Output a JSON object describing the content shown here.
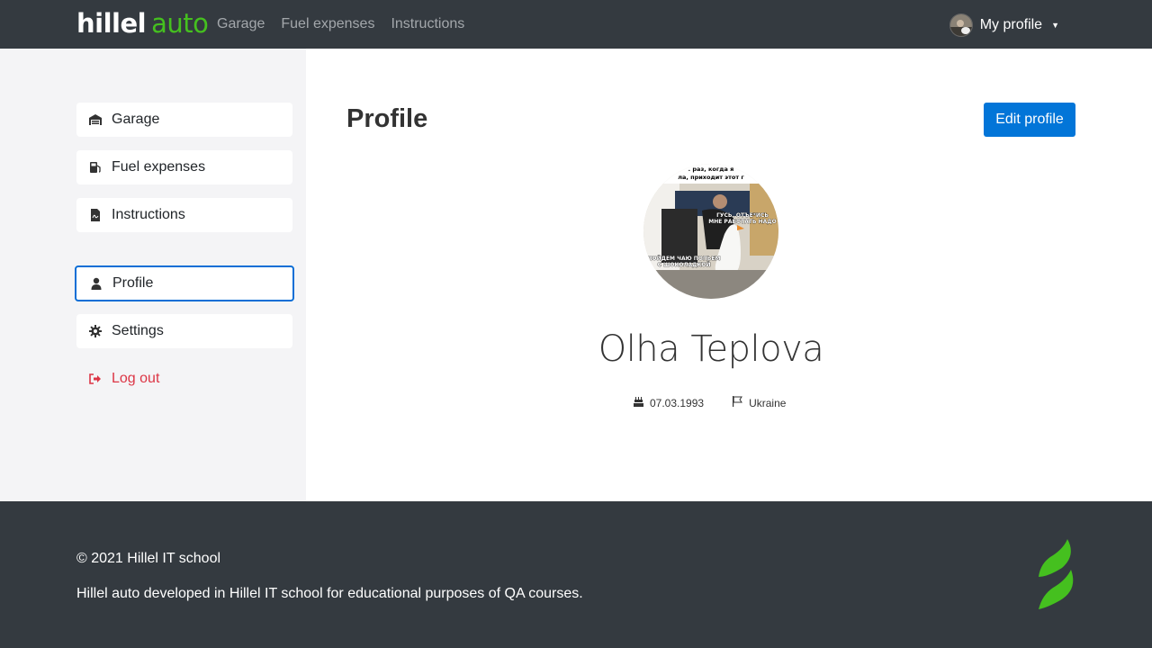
{
  "header": {
    "logo_hillel": "hillel",
    "logo_auto": "auto",
    "nav": [
      "Garage",
      "Fuel expenses",
      "Instructions"
    ],
    "profile_label": "My profile"
  },
  "sidebar": {
    "items": [
      {
        "label": "Garage",
        "icon": "garage-icon"
      },
      {
        "label": "Fuel expenses",
        "icon": "fuel-icon"
      },
      {
        "label": "Instructions",
        "icon": "document-icon"
      },
      {
        "label": "Profile",
        "icon": "user-icon",
        "active": true
      },
      {
        "label": "Settings",
        "icon": "gear-icon"
      },
      {
        "label": "Log out",
        "icon": "logout-icon"
      }
    ]
  },
  "main": {
    "title": "Profile",
    "edit_button": "Edit profile",
    "name": "Olha Teplova",
    "birth_date": "07.03.1993",
    "country": "Ukraine",
    "avatar_caption_top": ". раз, когда я\nла, приходит этот г",
    "avatar_caption_mid": "ГУСЬ, ОТЪЕ*ИСЬ\nМНЕ РАБОТАТЬ НАДО",
    "avatar_caption_bottom": "ПОЙДЕМ ЧАЮ ПОПЬЕМ\nС ШОКОЛАДКОЙ"
  },
  "footer": {
    "copyright": "© 2021 Hillel IT school",
    "description": "Hillel auto developed in Hillel IT school for educational purposes of QA courses."
  },
  "colors": {
    "header_bg": "#343a40",
    "accent_green": "#45c01f",
    "primary_blue": "#0275d8",
    "logout_red": "#dc3545",
    "sidebar_bg": "#f4f4f6"
  }
}
